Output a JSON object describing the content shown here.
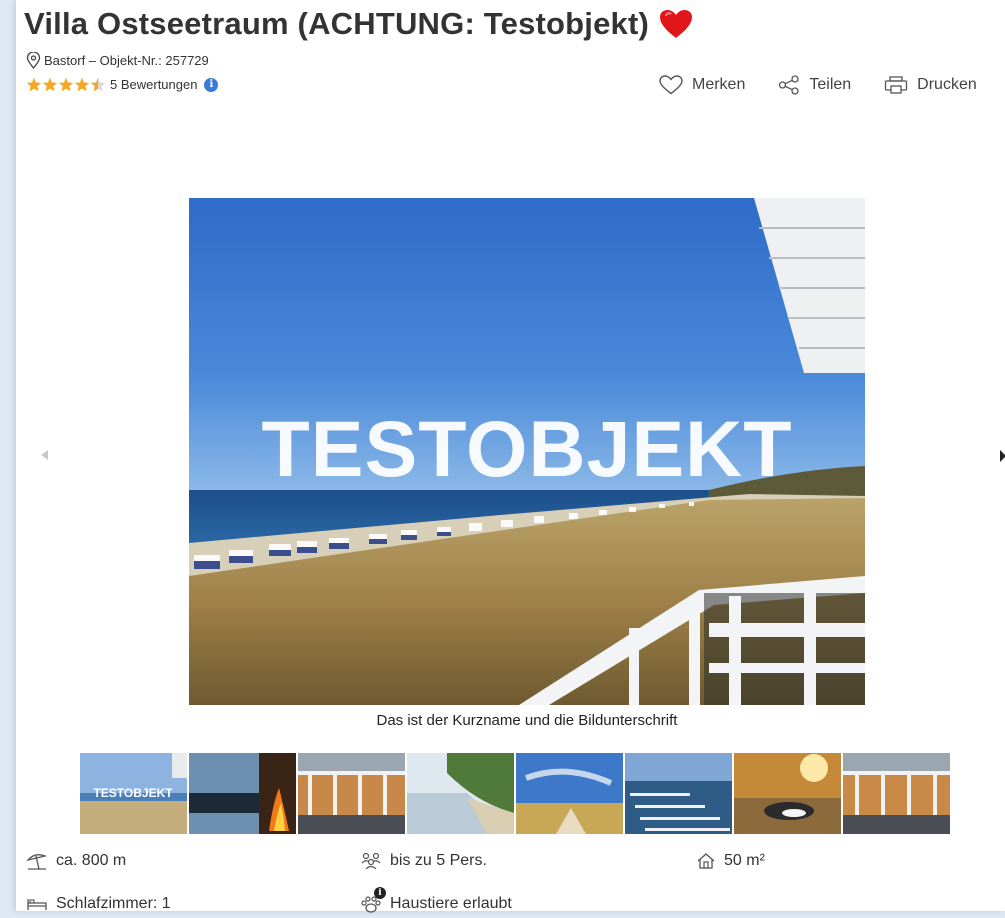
{
  "header": {
    "title": "Villa Ostseetraum (ACHTUNG: Testobjekt)",
    "heart_icon": "heart-icon",
    "location": "Bastorf – Objekt-Nr.: 257729",
    "rating_value": 4.5,
    "rating_max": 5,
    "reviews_label": "5 Bewertungen",
    "info_glyph": "i"
  },
  "actions": {
    "save_label": "Merken",
    "share_label": "Teilen",
    "print_label": "Drucken"
  },
  "gallery": {
    "hero_text": "TESTOBJEKT",
    "caption": "Das ist der Kurzname und die Bildunterschrift",
    "thumb_text": "TESTOBJEKT",
    "thumb_count": 8
  },
  "features": {
    "distance": "ca. 800 m",
    "persons": "bis zu 5 Pers.",
    "area": "50 m²",
    "bedrooms": "Schlafzimmer: 1",
    "pets": "Haustiere erlaubt",
    "pets_info_glyph": "i"
  },
  "colors": {
    "heart": "#e0161b",
    "star": "#f5a623",
    "info": "#3a7bd5",
    "sky": "#3f7ed6",
    "grass": "#b89a5a"
  }
}
